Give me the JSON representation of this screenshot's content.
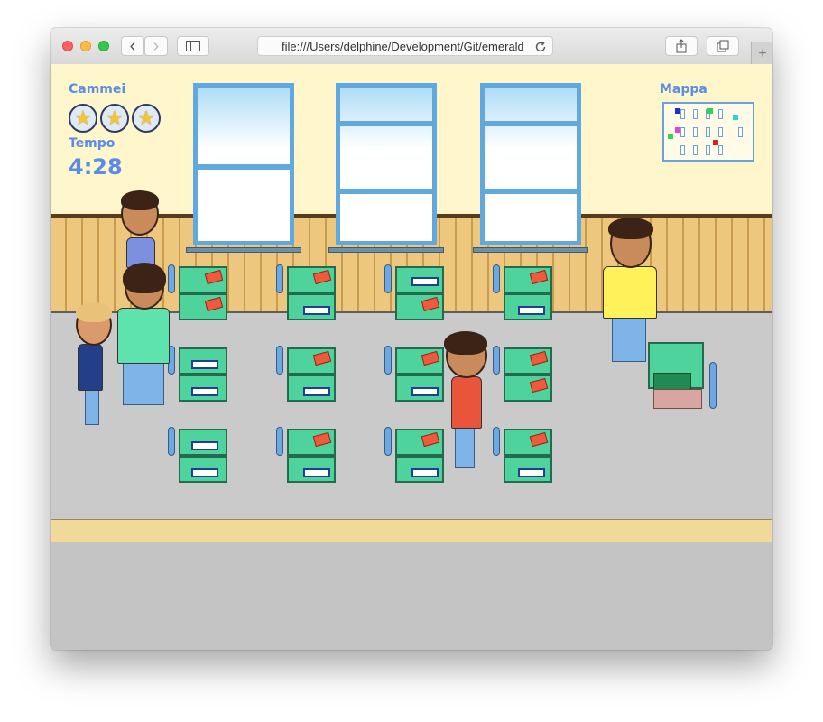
{
  "browser": {
    "url": "file:///Users/delphine/Development/Git/emerald",
    "new_tab_glyph": "+",
    "back_glyph": "‹",
    "forward_glyph": "›"
  },
  "hud": {
    "gems_label": "Cammei",
    "gems_count": 3,
    "star_glyph": "★",
    "time_label": "Tempo",
    "time_value": "4:28",
    "map_label": "Mappa"
  },
  "colors": {
    "hud_text": "#5b8de6",
    "wall": "#fff6cc",
    "floor": "#cacaca",
    "desk": "#4fd39c",
    "minimap_player": "#1a2fd8",
    "minimap_student_green": "#2fd35a",
    "minimap_student_cyan": "#29d6d0",
    "minimap_student_magenta": "#e640e0",
    "minimap_target": "#e02020"
  }
}
